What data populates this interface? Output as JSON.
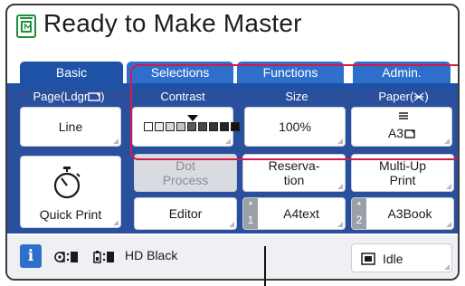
{
  "title": "Ready to Make Master",
  "tabs": [
    {
      "label": "Basic",
      "active": true
    },
    {
      "label": "Selections",
      "active": false
    },
    {
      "label": "Functions",
      "active": false
    },
    {
      "label": "Admin.",
      "active": false
    }
  ],
  "columns": {
    "page": {
      "label": "Page(Ldgr",
      "value": "Line"
    },
    "contrast": {
      "label": "Contrast",
      "level": 4,
      "levels": 9
    },
    "size": {
      "label": "Size",
      "value": "100%"
    },
    "paper": {
      "label": "Paper(",
      "label_close": ")",
      "value": "A3"
    }
  },
  "quick_print": {
    "label": "Quick Print"
  },
  "functions": {
    "dot_process": {
      "line1": "Dot",
      "line2": "Process",
      "enabled": false
    },
    "reservation": {
      "line1": "Reserva-",
      "line2": "tion"
    },
    "multi_up": {
      "line1": "Multi-Up",
      "line2": "Print"
    },
    "editor": {
      "label": "Editor"
    },
    "memory_1": {
      "badge_star": "*",
      "badge_num": "1",
      "label": "A4text"
    },
    "memory_2": {
      "badge_star": "*",
      "badge_num": "2",
      "label": "A3Book"
    }
  },
  "status": {
    "info_glyph": "i",
    "ink_label": "HD Black",
    "idle_label": "Idle"
  },
  "colors": {
    "tab_active": "#1e52a6",
    "tab_inactive": "#2f6fcc",
    "panel_blue": "#2a4f9c",
    "highlight_frame": "#d11a4f",
    "title_icon": "#1f8f3a"
  }
}
